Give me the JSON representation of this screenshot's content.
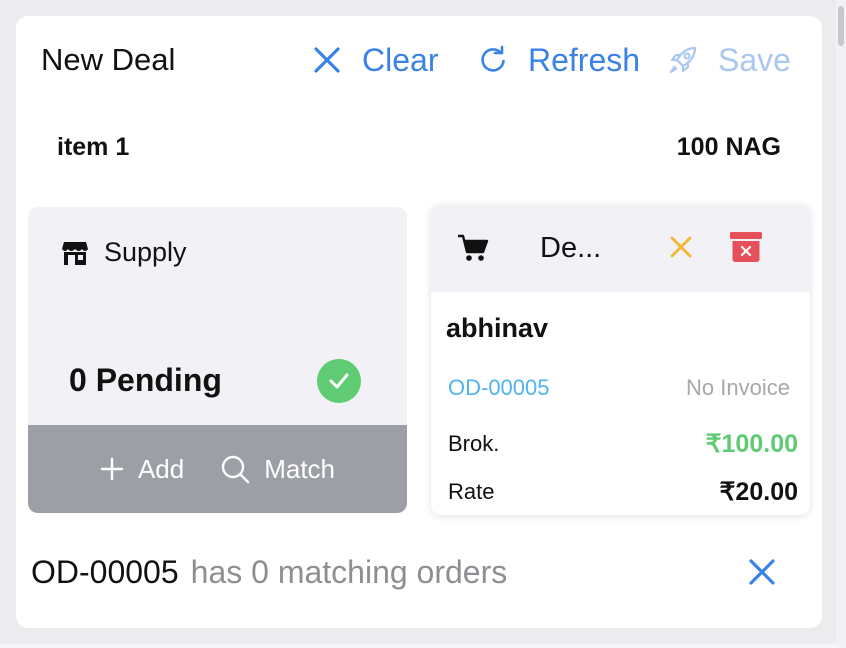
{
  "header": {
    "title": "New Deal",
    "clear_label": "Clear",
    "refresh_label": "Refresh",
    "save_label": "Save"
  },
  "item": {
    "name": "item 1",
    "quantity": "100 NAG"
  },
  "supply": {
    "label": "Supply",
    "pending": "0 Pending",
    "add_label": "Add",
    "match_label": "Match"
  },
  "deal": {
    "title": "De...",
    "party": "abhinav",
    "order_no": "OD-00005",
    "invoice_status": "No Invoice",
    "brokerage_label": "Brok.",
    "brokerage_value": "₹100.00",
    "rate_label": "Rate",
    "rate_value": "₹20.00"
  },
  "match_message": {
    "order": "OD-00005",
    "text": "has 0 matching orders"
  },
  "colors": {
    "accent": "#3b82e6",
    "accent_disabled": "#a9c7f1",
    "success": "#5fcc74",
    "warning": "#f5b731",
    "danger": "#e5505a",
    "link": "#4fb3ee"
  },
  "icons": {
    "clear": "close-icon",
    "refresh": "refresh-icon",
    "save": "rocket-icon",
    "supply": "store-icon",
    "pending_status": "check-circle-icon",
    "add": "plus-icon",
    "match": "search-icon",
    "deal": "cart-icon",
    "deal_cancel": "close-icon",
    "deal_delete": "trash-icon",
    "message_close": "close-icon"
  }
}
